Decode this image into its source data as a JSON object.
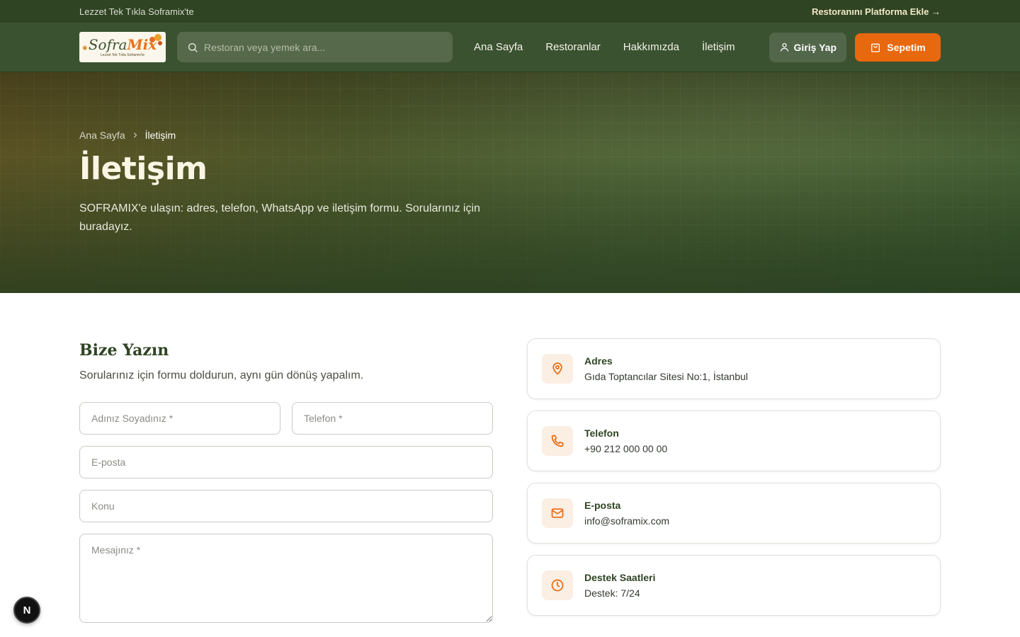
{
  "topbar": {
    "tagline": "Lezzet Tek Tıkla Soframix'te",
    "cta": "Restoranını Platforma Ekle →"
  },
  "logo": {
    "word_a": "Sofra",
    "word_b": "Mix",
    "slogan": "Lezzet Tek Tıkla Soframix'te"
  },
  "header": {
    "search_placeholder": "Restoran veya yemek ara...",
    "nav": [
      "Ana Sayfa",
      "Restoranlar",
      "Hakkımızda",
      "İletişim"
    ],
    "login_label": "Giriş Yap",
    "cart_label": "Sepetim"
  },
  "hero": {
    "breadcrumb": [
      "Ana Sayfa",
      "İletişim"
    ],
    "title": "İletişim",
    "description": "SOFRAMIX'e ulaşın: adres, telefon, WhatsApp ve iletişim formu. Sorularınız için buradayız."
  },
  "form": {
    "title": "Bize Yazın",
    "subtitle": "Sorularınız için formu doldurun, aynı gün dönüş yapalım.",
    "name_placeholder": "Adınız Soyadınız *",
    "phone_placeholder": "Telefon *",
    "email_placeholder": "E-posta",
    "subject_placeholder": "Konu",
    "message_placeholder": "Mesajınız *"
  },
  "contact_cards": [
    {
      "icon": "map-pin-icon",
      "title": "Adres",
      "value": "Gıda Toptancılar Sitesi No:1, İstanbul"
    },
    {
      "icon": "phone-icon",
      "title": "Telefon",
      "value": "+90 212 000 00 00"
    },
    {
      "icon": "mail-icon",
      "title": "E-posta",
      "value": "info@soframix.com"
    },
    {
      "icon": "clock-icon",
      "title": "Destek Saatleri",
      "value": "Destek: 7/24"
    }
  ],
  "dev_badge": "N",
  "colors": {
    "primary_green": "#2f4423",
    "accent_orange": "#e8680e",
    "icon_bg": "#fbeee3"
  }
}
